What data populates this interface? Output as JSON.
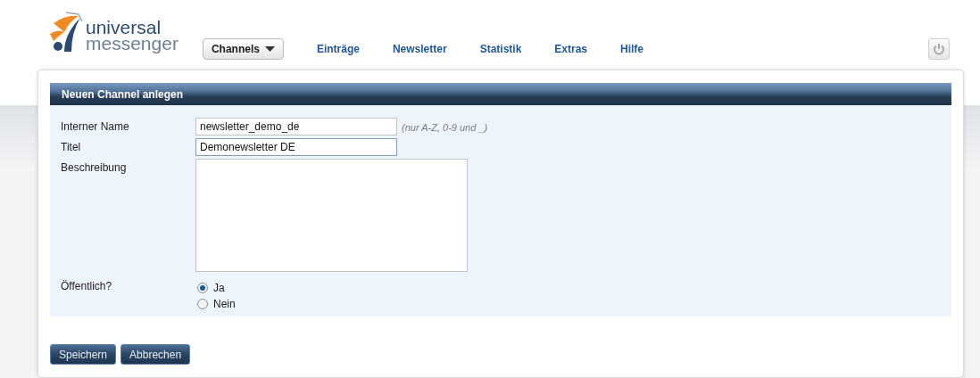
{
  "logo": {
    "line_1": "universal",
    "line_2": "messenger"
  },
  "nav": [
    {
      "label": "Channels",
      "selected": true,
      "kind": "dropdown"
    },
    {
      "label": "Einträge",
      "selected": false,
      "kind": "link"
    },
    {
      "label": "Newsletter",
      "selected": false,
      "kind": "link"
    },
    {
      "label": "Statistik",
      "selected": false,
      "kind": "link"
    },
    {
      "label": "Extras",
      "selected": false,
      "kind": "link"
    },
    {
      "label": "Hilfe",
      "selected": false,
      "kind": "link"
    }
  ],
  "panel_title": "Neuen Channel anlegen",
  "fields": [
    {
      "kind": "text",
      "label": "Interner Name",
      "value": "newsletter_demo_de",
      "hint": "(nur A-Z, 0-9 und _)",
      "focused": false
    },
    {
      "kind": "text",
      "label": "Titel",
      "value": "Demonewsletter DE",
      "focused": true
    },
    {
      "kind": "textarea",
      "label": "Beschreibung"
    },
    {
      "kind": "radio",
      "label": "Öffentlich?",
      "options": [
        {
          "label": "Ja",
          "selected": true
        },
        {
          "label": "Nein",
          "selected": false
        }
      ]
    }
  ],
  "buttons": [
    "Speichern",
    "Abbrechen"
  ]
}
